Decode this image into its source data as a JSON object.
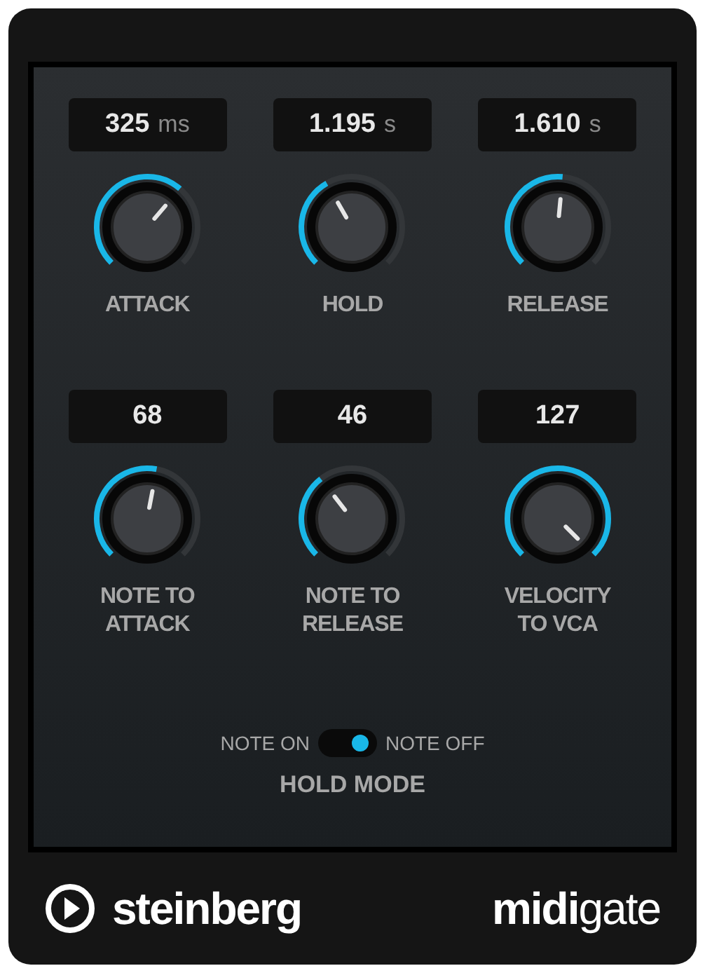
{
  "controls": [
    {
      "value": "325",
      "unit": "ms",
      "label": "ATTACK"
    },
    {
      "value": "1.195",
      "unit": "s",
      "label": "HOLD"
    },
    {
      "value": "1.610",
      "unit": "s",
      "label": "RELEASE"
    },
    {
      "value": "68",
      "label": "NOTE TO ATTACK"
    },
    {
      "value": "46",
      "label": "NOTE TO RELEASE"
    },
    {
      "value": "127",
      "label": "VELOCITY TO VCA"
    }
  ],
  "hold_mode": {
    "label": "HOLD MODE",
    "left_label": "NOTE ON",
    "right_label": "NOTE OFF",
    "on": true
  },
  "footer": {
    "brand": "steinberg",
    "product": "**midi**gate"
  }
}
